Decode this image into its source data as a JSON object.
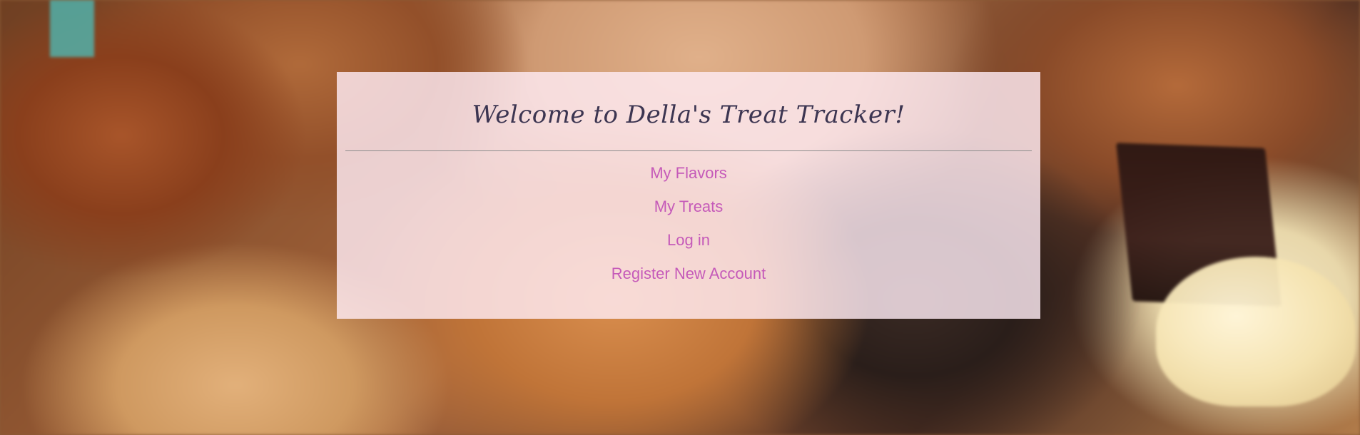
{
  "page": {
    "title": "Welcome to Della's Treat Tracker!"
  },
  "nav": {
    "items": [
      {
        "label": "My Flavors"
      },
      {
        "label": "My Treats"
      },
      {
        "label": "Log in"
      },
      {
        "label": "Register New Account"
      }
    ]
  },
  "colors": {
    "title": "#3c3551",
    "link": "#c55ab9",
    "card_background": "#ffecf4"
  }
}
